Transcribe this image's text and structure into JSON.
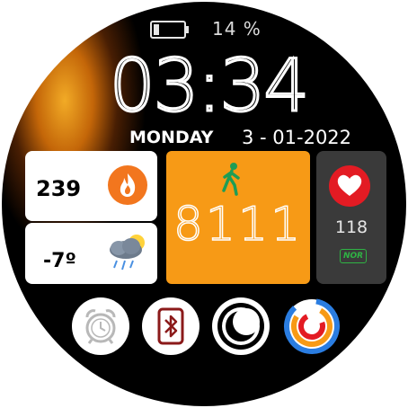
{
  "battery": {
    "percent_text": "14 %",
    "level": 0.14
  },
  "time": "03:34",
  "day": "MONDAY",
  "date": "3 - 01-2022",
  "calories": {
    "value": "239",
    "icon": "flame-icon"
  },
  "weather": {
    "value": "-7º",
    "icon": "cloud-rain-sun-icon"
  },
  "steps": {
    "value": "8111",
    "icon": "walking-icon"
  },
  "heart_rate": {
    "value": "118",
    "status": "NOR",
    "icon": "heart-icon"
  },
  "shortcuts": [
    "alarm-clock-icon",
    "bluetooth-icon",
    "moon-icon",
    "activity-rings-icon"
  ],
  "colors": {
    "accent": "#f79a16",
    "heart": "#e31b23",
    "flame": "#f2761e",
    "status_green": "#2fb344"
  }
}
